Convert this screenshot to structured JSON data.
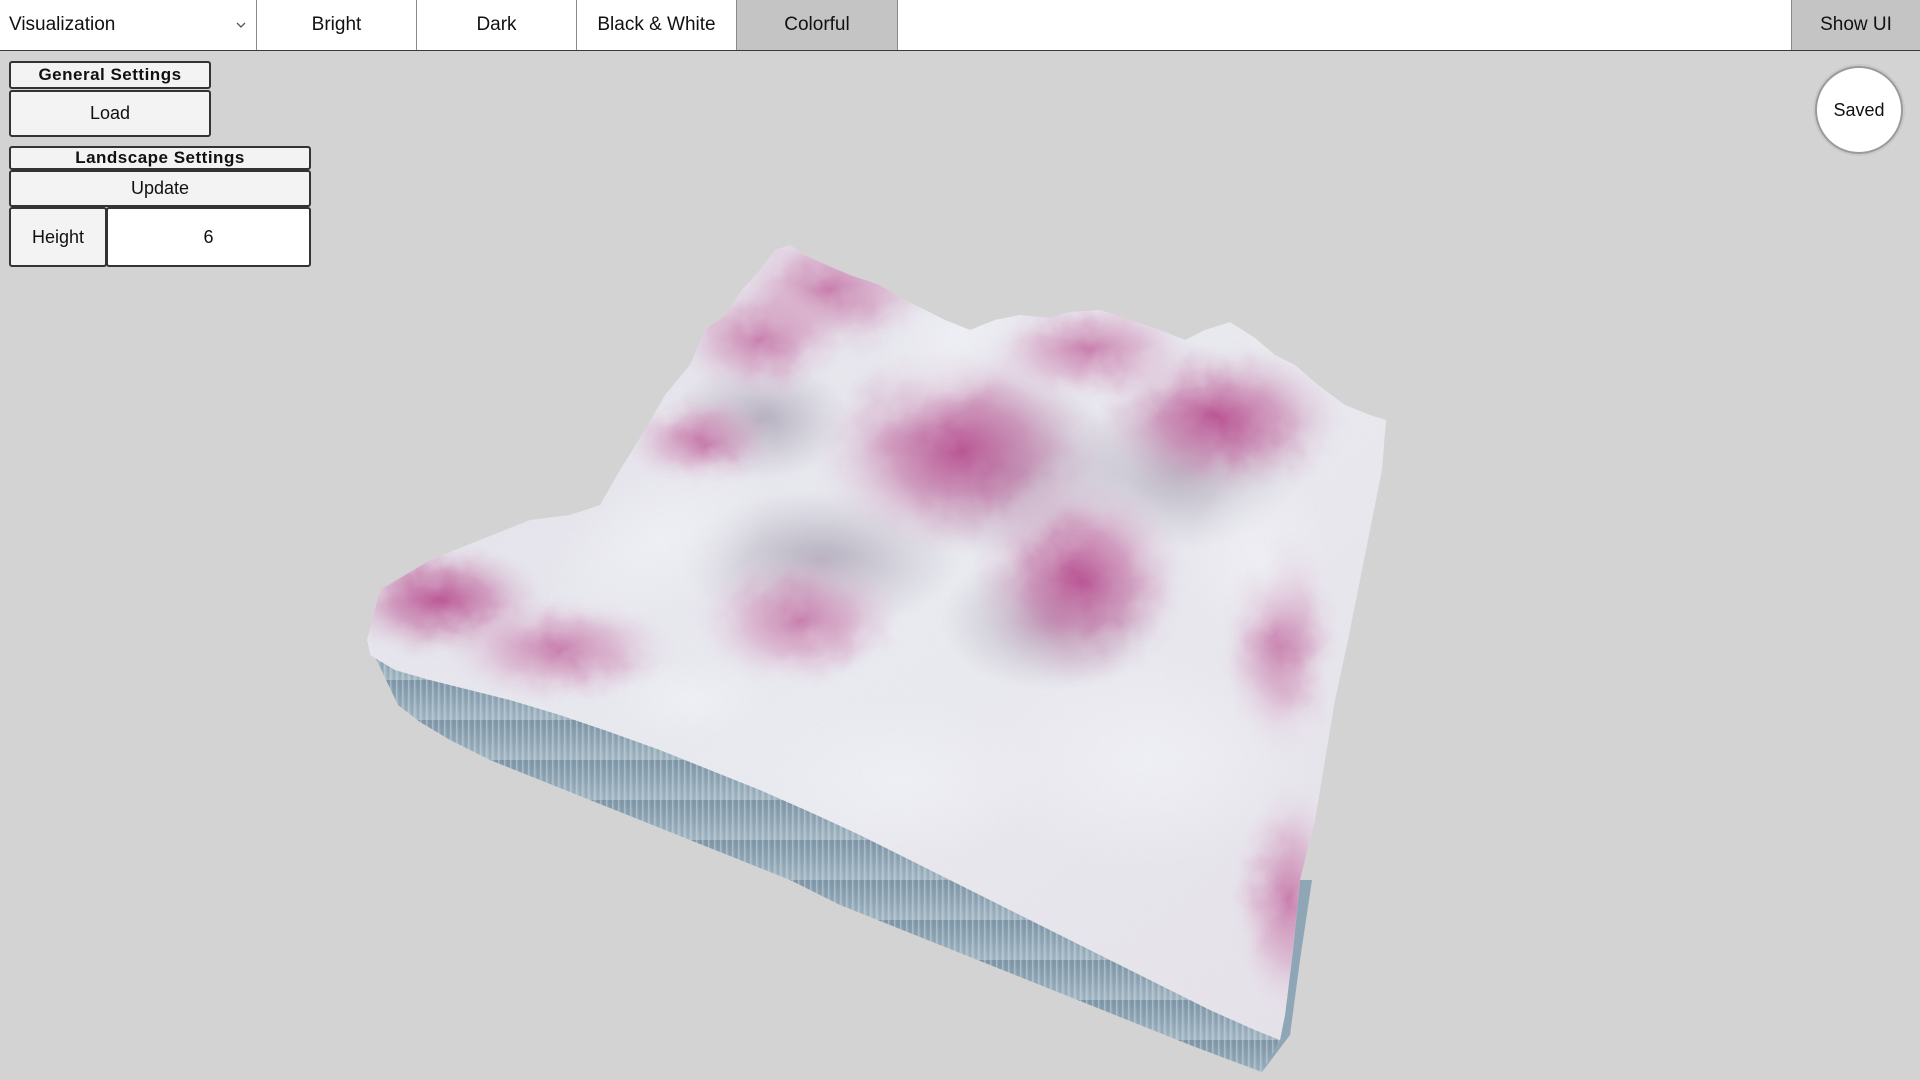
{
  "toolbar": {
    "visualization_select": "Visualization",
    "themes": [
      "Bright",
      "Dark",
      "Black & White",
      "Colorful"
    ],
    "active_theme": "Colorful",
    "show_ui_label": "Show UI"
  },
  "general_settings": {
    "header": "General Settings",
    "load_label": "Load"
  },
  "landscape_settings": {
    "header": "Landscape Settings",
    "update_label": "Update",
    "height_label": "Height",
    "height_value": "6"
  },
  "status": {
    "saved_label": "Saved"
  },
  "colors": {
    "background": "#d3d3d3",
    "active_tab": "#c4c4c4",
    "terrain_peak": "#c0609a",
    "terrain_snow": "#e8eaf0",
    "terrain_side": "#8fa8b8"
  }
}
